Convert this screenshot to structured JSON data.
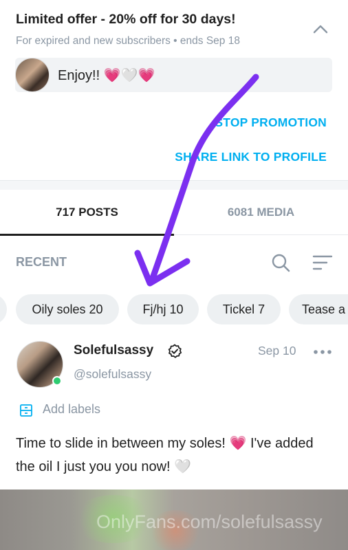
{
  "promo": {
    "title": "Limited offer - 20% off for 30 days!",
    "subtitle": "For expired and new subscribers  •  ends Sep 18",
    "message": "Enjoy!! 💗🤍💗",
    "stop_label": "STOP PROMOTION",
    "share_label": "SHARE LINK TO PROFILE"
  },
  "tabs": {
    "posts_label": "717 POSTS",
    "media_label": "6081 MEDIA"
  },
  "recent": {
    "label": "RECENT"
  },
  "chips": [
    "Oily soles 20",
    "Fj/hj 10",
    "Tickel 7",
    "Tease a"
  ],
  "post": {
    "name": "Solefulsassy",
    "handle": "@solefulsassy",
    "date": "Sep 10",
    "add_labels": "Add labels",
    "text": "Time to slide in between my soles! 💗 I've added the oil I just you you now! 🤍",
    "watermark": "OnlyFans.com/solefulsassy"
  },
  "colors": {
    "accent": "#00aff0",
    "muted": "#8a96a3",
    "online": "#2ecc71",
    "annotation_arrow": "#7b2ff0"
  },
  "icons": {
    "collapse": "chevron-up-icon",
    "search": "search-icon",
    "sort": "sort-icon",
    "verified": "verified-badge-icon",
    "more": "more-dots-icon",
    "labels": "bookmark-label-icon"
  }
}
